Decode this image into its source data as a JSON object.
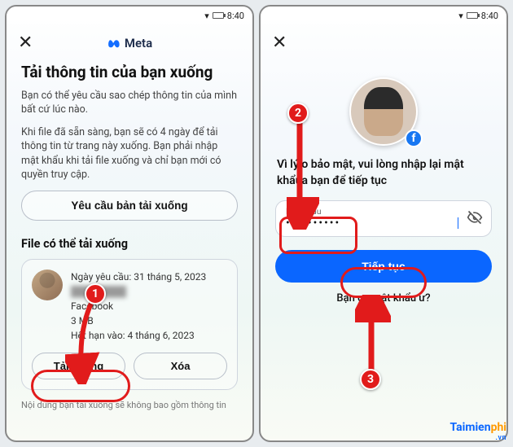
{
  "status": {
    "time": "8:40"
  },
  "brand": "Meta",
  "left": {
    "title": "Tải thông tin của bạn xuống",
    "p1": "Bạn có thể yêu cầu sao chép thông tin của mình bất cứ lúc nào.",
    "p2": "Khi file đã sẵn sàng, bạn sẽ có 4 ngày để tải thông tin từ trang này xuống. Bạn phải nhập mật khẩu khi tải file xuống và chỉ bạn mới có quyền truy cập.",
    "request_btn": "Yêu cầu bản tải xuống",
    "section": "File có thể tải xuống",
    "file": {
      "requested": "Ngày yêu cầu: 31 tháng 5, 2023",
      "name_blur": "████████",
      "source": "Facebook",
      "size": "3 MB",
      "expires": "Hết hạn vào: 4 tháng 6, 2023",
      "download": "Tải xuống",
      "delete": "Xóa"
    },
    "footnote": "Nội dung bạn tải xuống sẽ không bao gồm thông tin"
  },
  "right": {
    "prompt_a": "Vì lý ",
    "prompt_b": "o bảo mật, vui lòng nhập lại mật khẩ",
    "prompt_c": "ủa bạn để tiếp tục",
    "pw_label": "Mật khẩu",
    "pw_value": "••••••••••",
    "continue": "Tiếp tục",
    "forgot": "Bạn q",
    "forgot2": "n mật khẩu ư?"
  },
  "annotations": {
    "n1": "1",
    "n2": "2",
    "n3": "3"
  },
  "watermark": {
    "b1": "Taimien",
    "b2": "phi",
    "sub": ".vn"
  }
}
